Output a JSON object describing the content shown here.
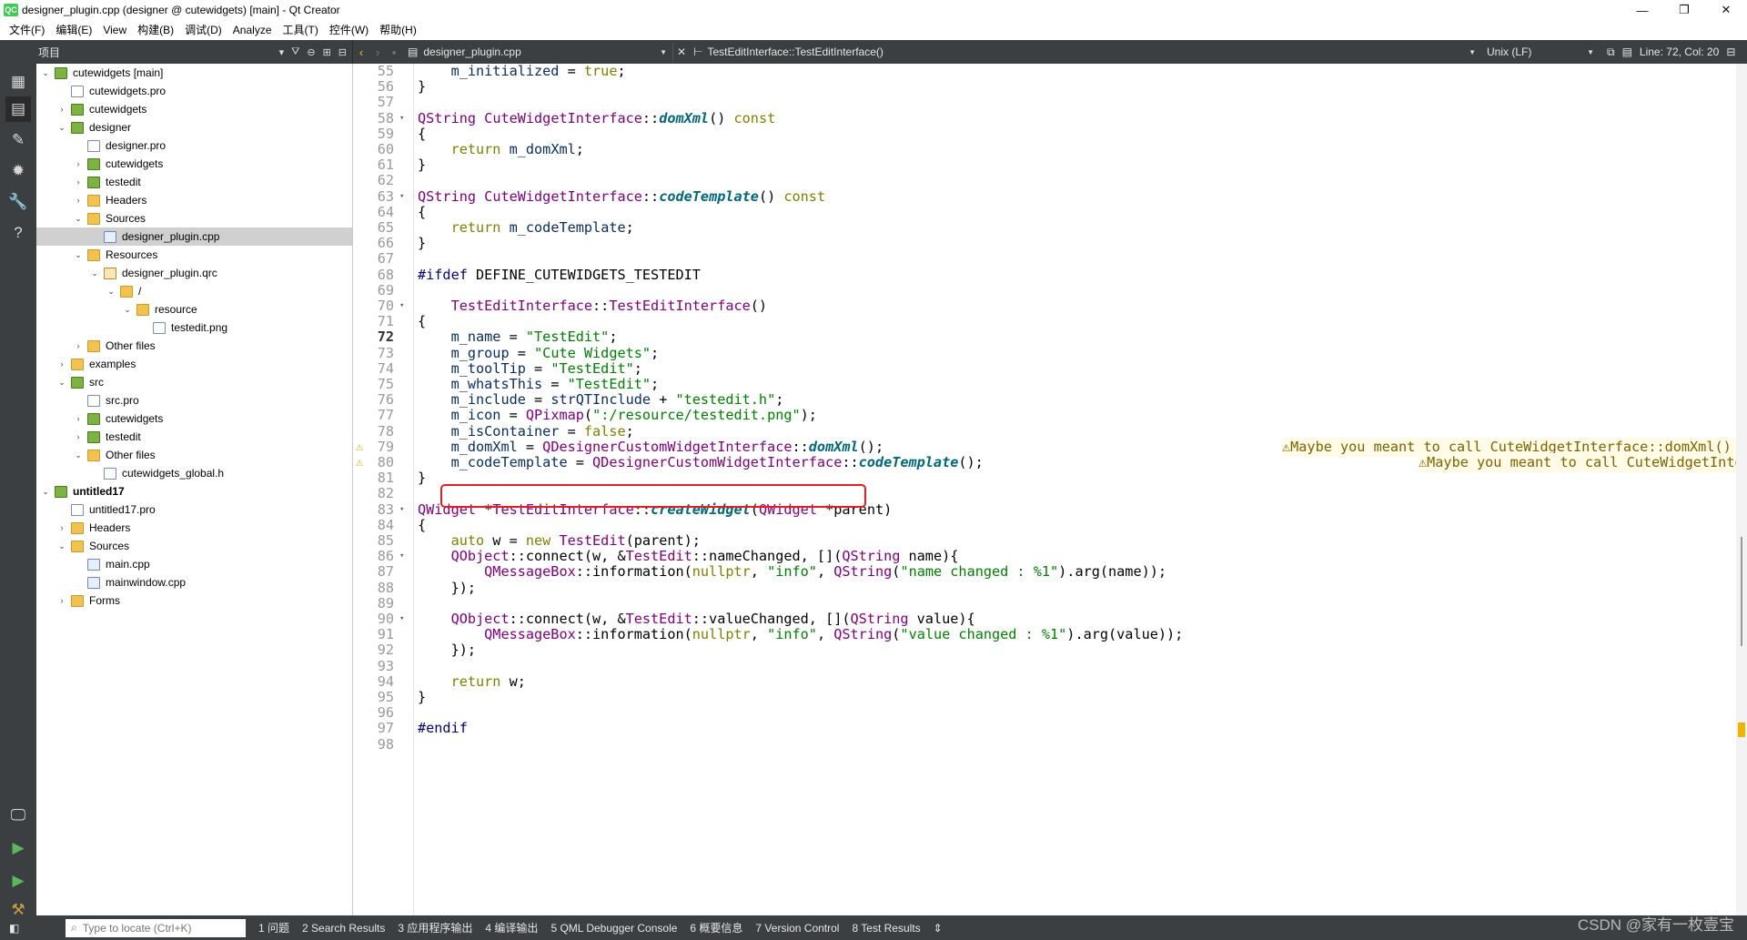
{
  "window": {
    "title": "designer_plugin.cpp (designer @ cutewidgets) [main] - Qt Creator",
    "logo": "QC"
  },
  "menu": [
    "文件(F)",
    "编辑(E)",
    "View",
    "构建(B)",
    "调试(D)",
    "Analyze",
    "工具(T)",
    "控件(W)",
    "帮助(H)"
  ],
  "project_pane": {
    "header": "项目",
    "items": [
      {
        "label": "cutewidgets [main]",
        "icon": "project-icon",
        "arrow": "v",
        "bold": false
      },
      {
        "label": "cutewidgets.pro",
        "icon": "file-icon",
        "arrow": "",
        "bold": false
      },
      {
        "label": "cutewidgets",
        "icon": "project-icon",
        "arrow": ">",
        "bold": false
      },
      {
        "label": "designer",
        "icon": "project-icon",
        "arrow": "v",
        "bold": false
      },
      {
        "label": "designer.pro",
        "icon": "file-icon",
        "arrow": "",
        "bold": false
      },
      {
        "label": "cutewidgets",
        "icon": "project-icon",
        "arrow": ">",
        "bold": false
      },
      {
        "label": "testedit",
        "icon": "project-icon",
        "arrow": ">",
        "bold": false
      },
      {
        "label": "Headers",
        "icon": "folder-icon",
        "arrow": ">",
        "bold": false
      },
      {
        "label": "Sources",
        "icon": "folder-icon",
        "arrow": "v",
        "bold": false
      },
      {
        "label": "designer_plugin.cpp",
        "icon": "source-file-icon",
        "arrow": "",
        "bold": false,
        "selected": true
      },
      {
        "label": "Resources",
        "icon": "folder-icon",
        "arrow": "v",
        "bold": false
      },
      {
        "label": "designer_plugin.qrc",
        "icon": "qrc-file-icon",
        "arrow": "v",
        "bold": false
      },
      {
        "label": "/",
        "icon": "folder-icon",
        "arrow": "v",
        "bold": false
      },
      {
        "label": "resource",
        "icon": "folder-icon",
        "arrow": "v",
        "bold": false
      },
      {
        "label": "testedit.png",
        "icon": "image-file-icon",
        "arrow": "",
        "bold": false
      },
      {
        "label": "Other files",
        "icon": "folder-icon",
        "arrow": ">",
        "bold": false
      },
      {
        "label": "examples",
        "icon": "folder-icon",
        "arrow": ">",
        "bold": false
      },
      {
        "label": "src",
        "icon": "project-icon",
        "arrow": "v",
        "bold": false
      },
      {
        "label": "src.pro",
        "icon": "file-icon",
        "arrow": "",
        "bold": false
      },
      {
        "label": "cutewidgets",
        "icon": "project-icon",
        "arrow": ">",
        "bold": false
      },
      {
        "label": "testedit",
        "icon": "project-icon",
        "arrow": ">",
        "bold": false
      },
      {
        "label": "Other files",
        "icon": "folder-icon",
        "arrow": "v",
        "bold": false
      },
      {
        "label": "cutewidgets_global.h",
        "icon": "header-file-icon",
        "arrow": "",
        "bold": false
      },
      {
        "label": "untitled17",
        "icon": "project-icon",
        "arrow": "v",
        "bold": true
      },
      {
        "label": "untitled17.pro",
        "icon": "file-icon",
        "arrow": "",
        "bold": false
      },
      {
        "label": "Headers",
        "icon": "folder-icon",
        "arrow": ">",
        "bold": false
      },
      {
        "label": "Sources",
        "icon": "folder-icon",
        "arrow": "v",
        "bold": false
      },
      {
        "label": "main.cpp",
        "icon": "source-file-icon",
        "arrow": "",
        "bold": false
      },
      {
        "label": "mainwindow.cpp",
        "icon": "source-file-icon",
        "arrow": "",
        "bold": false
      },
      {
        "label": "Forms",
        "icon": "folder-icon",
        "arrow": ">",
        "bold": false
      }
    ]
  },
  "editor_toolbar": {
    "file": "designer_plugin.cpp",
    "symbol": "TestEditInterface::TestEditInterface()",
    "line_ending": "Unix (LF)",
    "position": "Line: 72, Col: 20"
  },
  "code": {
    "current_line": 72,
    "lines": [
      {
        "n": "55",
        "t": "    m_initialized = true;"
      },
      {
        "n": "56",
        "t": "}"
      },
      {
        "n": "57",
        "t": ""
      },
      {
        "n": "58",
        "t": "QString CuteWidgetInterface::domXml() const",
        "fold": true
      },
      {
        "n": "59",
        "t": "{"
      },
      {
        "n": "60",
        "t": "    return m_domXml;"
      },
      {
        "n": "61",
        "t": "}"
      },
      {
        "n": "62",
        "t": ""
      },
      {
        "n": "63",
        "t": "QString CuteWidgetInterface::codeTemplate() const",
        "fold": true
      },
      {
        "n": "64",
        "t": "{"
      },
      {
        "n": "65",
        "t": "    return m_codeTemplate;"
      },
      {
        "n": "66",
        "t": "}"
      },
      {
        "n": "67",
        "t": ""
      },
      {
        "n": "68",
        "t": "#ifdef DEFINE_CUTEWIDGETS_TESTEDIT"
      },
      {
        "n": "69",
        "t": ""
      },
      {
        "n": "70",
        "t": "    TestEditInterface::TestEditInterface()",
        "fold": true
      },
      {
        "n": "71",
        "t": "{"
      },
      {
        "n": "72",
        "t": "    m_name = \"TestEdit\";"
      },
      {
        "n": "73",
        "t": "    m_group = \"Cute Widgets\";"
      },
      {
        "n": "74",
        "t": "    m_toolTip = \"TestEdit\";"
      },
      {
        "n": "75",
        "t": "    m_whatsThis = \"TestEdit\";"
      },
      {
        "n": "76",
        "t": "    m_include = strQTInclude + \"testedit.h\";"
      },
      {
        "n": "77",
        "t": "    m_icon = QPixmap(\":/resource/testedit.png\");"
      },
      {
        "n": "78",
        "t": "    m_isContainer = false;"
      },
      {
        "n": "79",
        "t": "    m_domXml = QDesignerCustomWidgetInterface::domXml();",
        "warn": "⚠Maybe you meant to call CuteWidgetInterface::domXml() instead [clazy-skipped-base…"
      },
      {
        "n": "80",
        "t": "    m_codeTemplate = QDesignerCustomWidgetInterface::codeTemplate();",
        "warn": "⚠Maybe you meant to call CuteWidgetInterface::codeTemplate() instead […"
      },
      {
        "n": "81",
        "t": "}"
      },
      {
        "n": "82",
        "t": ""
      },
      {
        "n": "83",
        "t": "QWidget *TestEditInterface::createWidget(QWidget *parent)",
        "fold": true
      },
      {
        "n": "84",
        "t": "{"
      },
      {
        "n": "85",
        "t": "    auto w = new TestEdit(parent);"
      },
      {
        "n": "86",
        "t": "    QObject::connect(w, &TestEdit::nameChanged, [](QString name){",
        "fold": true
      },
      {
        "n": "87",
        "t": "        QMessageBox::information(nullptr, \"info\", QString(\"name changed : %1\").arg(name));"
      },
      {
        "n": "88",
        "t": "    });"
      },
      {
        "n": "89",
        "t": ""
      },
      {
        "n": "90",
        "t": "    QObject::connect(w, &TestEdit::valueChanged, [](QString value){",
        "fold": true
      },
      {
        "n": "91",
        "t": "        QMessageBox::information(nullptr, \"info\", QString(\"value changed : %1\").arg(value));"
      },
      {
        "n": "92",
        "t": "    });"
      },
      {
        "n": "93",
        "t": ""
      },
      {
        "n": "94",
        "t": "    return w;"
      },
      {
        "n": "95",
        "t": "}"
      },
      {
        "n": "96",
        "t": ""
      },
      {
        "n": "97",
        "t": "#endif"
      },
      {
        "n": "98",
        "t": ""
      }
    ]
  },
  "statusbar": {
    "locate_placeholder": "Type to locate (Ctrl+K)",
    "tabs": [
      "1 问题",
      "2 Search Results",
      "3 应用程序输出",
      "4 编译输出",
      "5 QML Debugger Console",
      "6 概要信息",
      "7 Version Control",
      "8 Test Results"
    ]
  },
  "watermark": "CSDN @家有一枚壹宝",
  "colors": {
    "highlight_box": "#e02020",
    "warning": "#e6a700",
    "sidebar": "#3c3f41"
  }
}
